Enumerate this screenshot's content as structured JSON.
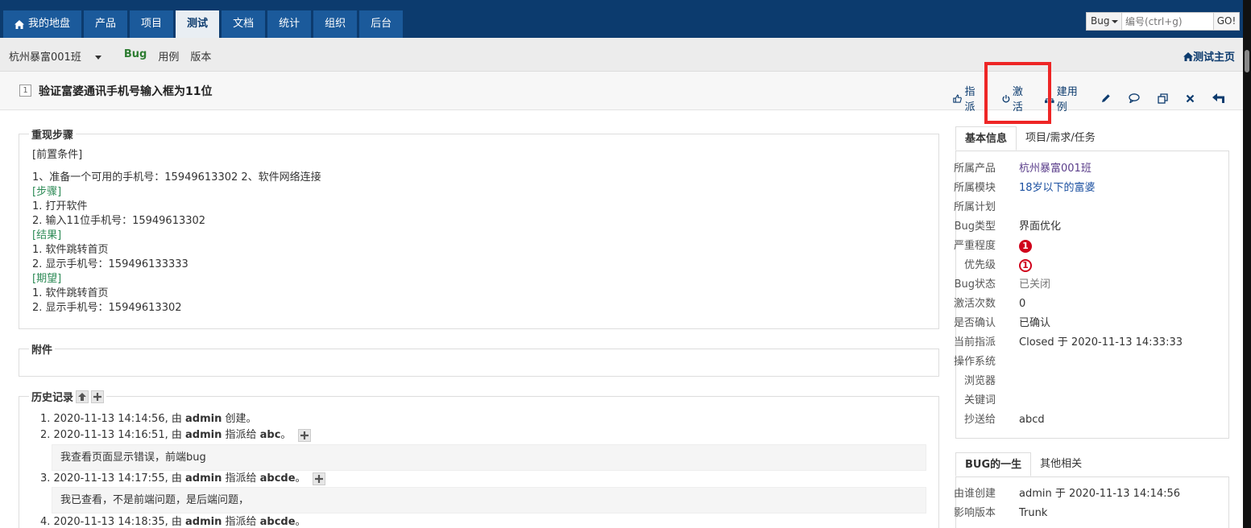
{
  "nav": {
    "items": [
      {
        "label": "我的地盘"
      },
      {
        "label": "产品"
      },
      {
        "label": "项目"
      },
      {
        "label": "测试"
      },
      {
        "label": "文档"
      },
      {
        "label": "统计"
      },
      {
        "label": "组织"
      },
      {
        "label": "后台"
      }
    ],
    "active_index": 3
  },
  "search": {
    "type": "Bug",
    "placeholder": "编号(ctrl+g)",
    "go": "GO!"
  },
  "subnav": {
    "product": "杭州暴富001班",
    "bug": "Bug",
    "case": "用例",
    "version": "版本",
    "test_home": "测试主页"
  },
  "bug": {
    "id": "1",
    "title": "验证富婆通讯手机号输入框为11位"
  },
  "actions": {
    "assign": "指派",
    "activate": "激活",
    "create_case": "建用例"
  },
  "steps": {
    "legend": "重现步骤",
    "precondition_label": "[前置条件]",
    "precondition": "1、准备一个可用的手机号：15949613302 2、软件网络连接",
    "steps_label": "[步骤]",
    "steps": [
      "1. 打开软件",
      "2. 输入11位手机号：15949613302"
    ],
    "result_label": "[结果]",
    "results": [
      "1. 软件跳转首页",
      "2. 显示手机号：159496133333"
    ],
    "expect_label": "[期望]",
    "expects": [
      "1. 软件跳转首页",
      "2. 显示手机号：15949613302"
    ]
  },
  "attachments": {
    "legend": "附件"
  },
  "history": {
    "legend": "历史记录",
    "entries": [
      {
        "prefix": "1. 2020-11-13 14:14:56, 由 ",
        "user": "admin",
        "action": " 创建。",
        "target": ""
      },
      {
        "prefix": "2. 2020-11-13 14:16:51, 由 ",
        "user": "admin",
        "action": " 指派给 ",
        "target": "abc",
        "suffix": "。",
        "comment": "我查看页面显示错误，前端bug"
      },
      {
        "prefix": "3. 2020-11-13 14:17:55, 由 ",
        "user": "admin",
        "action": " 指派给 ",
        "target": "abcde",
        "suffix": "。",
        "comment": "我已查看，不是前端问题，是后端问题，"
      },
      {
        "prefix": "4. 2020-11-13 14:18:35, 由 ",
        "user": "admin",
        "action": " 指派给 ",
        "target": "abcde",
        "suffix": "。"
      }
    ]
  },
  "basic_info": {
    "tabs": [
      "基本信息",
      "项目/需求/任务"
    ],
    "rows": [
      {
        "label": "所属产品",
        "value": "杭州暴富001班"
      },
      {
        "label": "所属模块",
        "value": "18岁以下的富婆"
      },
      {
        "label": "所属计划",
        "value": ""
      },
      {
        "label": "Bug类型",
        "value": "界面优化"
      },
      {
        "label": "严重程度",
        "value": "1"
      },
      {
        "label": "优先级",
        "value": "1"
      },
      {
        "label": "Bug状态",
        "value": "已关闭"
      },
      {
        "label": "激活次数",
        "value": "0"
      },
      {
        "label": "是否确认",
        "value": "已确认"
      },
      {
        "label": "当前指派",
        "value": "Closed 于 2020-11-13 14:33:33"
      },
      {
        "label": "操作系统",
        "value": ""
      },
      {
        "label": "浏览器",
        "value": ""
      },
      {
        "label": "关键词",
        "value": ""
      },
      {
        "label": "抄送给",
        "value": "abcd"
      }
    ]
  },
  "life": {
    "tabs": [
      "BUG的一生",
      "其他相关"
    ],
    "rows": [
      {
        "label": "由谁创建",
        "value": "admin 于 2020-11-13 14:14:56"
      },
      {
        "label": "影响版本",
        "value": "Trunk"
      }
    ]
  }
}
